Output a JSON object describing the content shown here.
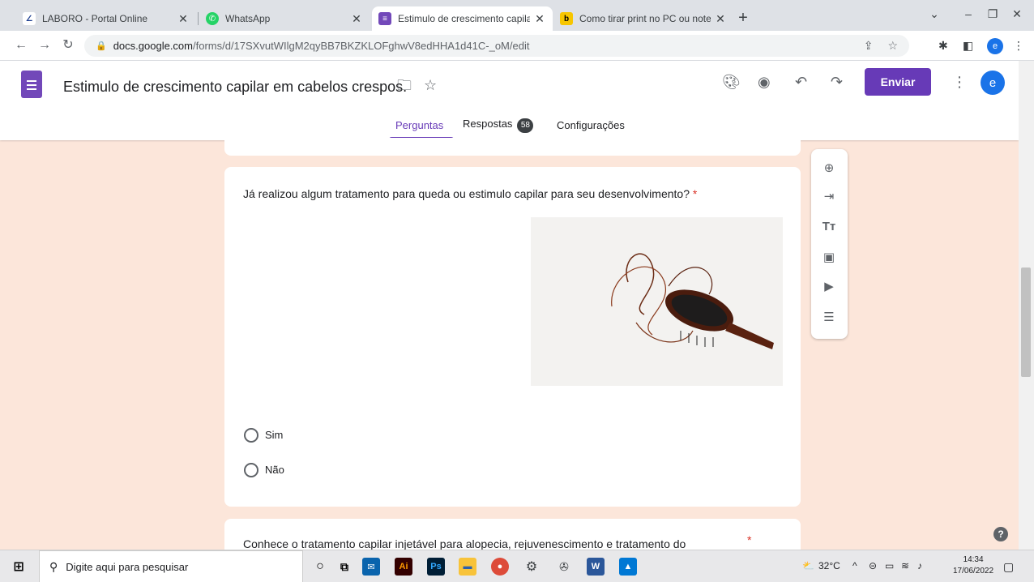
{
  "browser": {
    "tabs": [
      {
        "title": "LABORO - Portal Online",
        "favicon": "laboro-icon",
        "active": false
      },
      {
        "title": "WhatsApp",
        "favicon": "whatsapp-icon",
        "active": false
      },
      {
        "title": "Estimulo de crescimento capilar",
        "favicon": "google-forms-icon",
        "active": true
      },
      {
        "title": "Como tirar print no PC ou notebo",
        "favicon": "b-icon",
        "active": false
      }
    ],
    "new_tab": "+",
    "url_host": "docs.google.com",
    "url_path": "/forms/d/17SXvutWIlgM2qyBB7BKZKLOFghwV8edHHA1d41C-_oM/edit",
    "profile_initial": "e"
  },
  "form_header": {
    "title": "Estimulo de crescimento capilar em cabelos crespos.",
    "send_label": "Enviar",
    "user_initial": "e",
    "tabs": [
      {
        "label": "Perguntas",
        "active": true
      },
      {
        "label": "Respostas",
        "badge": "58"
      },
      {
        "label": "Configurações"
      }
    ]
  },
  "questions": [
    {
      "text": "Já realizou algum tratamento para queda ou estimulo capilar para seu desenvolvimento?",
      "required_mark": "*",
      "image": "hairbrush-with-hair-image",
      "options": [
        "Sim",
        "Não"
      ]
    },
    {
      "text": "Conhece o tratamento capilar injetável para alopecia, rejuvenescimento e tratamento do",
      "required_mark": "*"
    }
  ],
  "side_toolbar": [
    "add-question-icon",
    "import-questions-icon",
    "add-title-icon",
    "add-image-icon",
    "add-video-icon",
    "add-section-icon"
  ],
  "help_label": "?",
  "taskbar": {
    "search_placeholder": "Digite aqui para pesquisar",
    "weather": "32°C",
    "time": "14:34",
    "date": "17/06/2022"
  },
  "colors": {
    "forms_purple": "#673ab7",
    "background": "#fce6da",
    "required_red": "#d93025"
  }
}
